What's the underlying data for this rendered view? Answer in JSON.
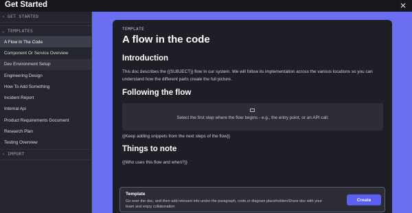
{
  "window": {
    "title": "Get Started",
    "close_icon": "close-icon"
  },
  "sidebar": {
    "get_started_header": "GET STARTED",
    "templates_header": "TEMPLATES",
    "import_header": "IMPORT",
    "items": [
      {
        "label": "A Flow In The Code"
      },
      {
        "label": "Component Or Service Overview"
      },
      {
        "label": "Dev Environment Setup"
      },
      {
        "label": "Engineering Design"
      },
      {
        "label": "How To Add Something"
      },
      {
        "label": "Incident Report"
      },
      {
        "label": "Internal Api"
      },
      {
        "label": "Product Requirements Document"
      },
      {
        "label": "Research Plan"
      },
      {
        "label": "Testing Overview"
      }
    ]
  },
  "preview": {
    "label": "TEMPLATE",
    "title": "A flow in the code",
    "intro_heading": "Introduction",
    "intro_text": "This doc describes the {{SUBJECT}} flow in our system. We will follow its implementation across the various locations so you can understand how the different parts create the full picture.",
    "flow_heading": "Following the flow",
    "snippet_text": "Select the first step where the flow begins - e.g., the entry point, or an API call.",
    "flow_more": "{{Keep adding snippets from the next steps of the flow}}",
    "notes_heading": "Things to note",
    "notes_text": "{{Who uses this flow and when?}}"
  },
  "banner": {
    "title": "Template",
    "description": "Go over the doc, and then add relevant info under the paragraph, code,or diagram placeholdersShare doc with your team and enjoy collaboration",
    "create_label": "Create"
  },
  "colors": {
    "accent": "#5b5ff0",
    "background": "#6a6ef0"
  }
}
